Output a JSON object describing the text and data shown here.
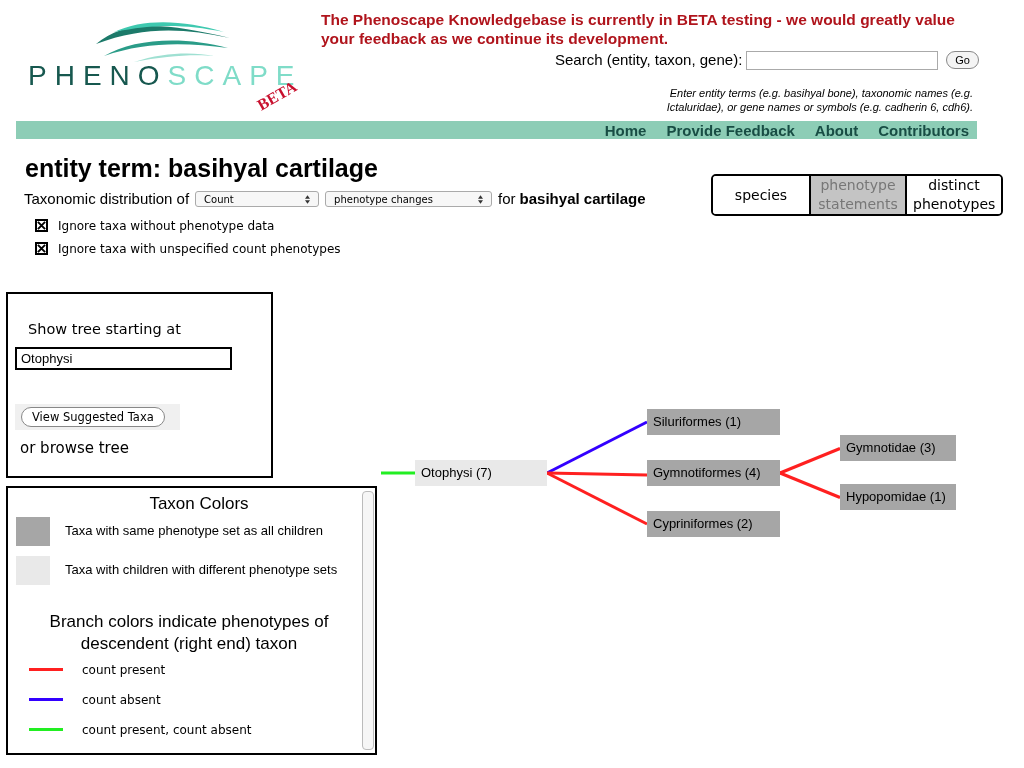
{
  "logo": {
    "text_dark": "PHENO",
    "text_light": "SCAPE",
    "badge": "BETA"
  },
  "notice": "The Phenoscape Knowledgebase is currently in BETA testing - we would greatly value your feedback as we continue its development.",
  "search": {
    "label": "Search (entity, taxon, gene):",
    "button": "Go",
    "hint": "Enter entity terms (e.g. basihyal bone), taxonomic names (e.g. Ictaluridae), or gene names or symbols (e.g. cadherin 6, cdh6)."
  },
  "nav": [
    "Home",
    "Provide Feedback",
    "About",
    "Contributors"
  ],
  "title": "entity term: basihyal cartilage",
  "distribution": {
    "prefix": "Taxonomic distribution of",
    "select_1": "Count",
    "select_2": "phenotype changes",
    "middle": "for",
    "term": "basihyal cartilage"
  },
  "options": [
    {
      "label": "Ignore taxa without phenotype data",
      "checked": true
    },
    {
      "label": "Ignore taxa with unspecified count phenotypes",
      "checked": true
    }
  ],
  "count_tabs": [
    {
      "label": "species",
      "selected": false
    },
    {
      "label": "phenotype statements",
      "selected": true
    },
    {
      "label": "distinct phenotypes",
      "selected": false
    }
  ],
  "tree_start": {
    "label": "Show tree starting at",
    "value": "Otophysi",
    "button": "View Suggested Taxa",
    "browse": "or browse tree"
  },
  "legend": {
    "title": "Taxon Colors",
    "taxon_colors": [
      {
        "kind": "uniform",
        "label": "Taxa with same phenotype set as all children"
      },
      {
        "kind": "mixed",
        "label": "Taxa with children with different phenotype sets"
      }
    ],
    "branch_title": "Branch colors indicate phenotypes of descendent (right end) taxon",
    "branch_colors": [
      {
        "color": "#ff2020",
        "label": "count present"
      },
      {
        "color": "#3300ff",
        "label": "count absent"
      },
      {
        "color": "#22ee22",
        "label": "count present, count absent"
      }
    ]
  },
  "tree": {
    "label": "Otophysi (7)",
    "kind": "mixed",
    "color": "#22ee22",
    "children": [
      {
        "label": "Siluriformes (1)",
        "kind": "uniform",
        "color": "#3300ff"
      },
      {
        "label": "Gymnotiformes (4)",
        "kind": "uniform",
        "color": "#ff2020",
        "children": [
          {
            "label": "Gymnotidae (3)",
            "kind": "uniform",
            "color": "#ff2020"
          },
          {
            "label": "Hypopomidae (1)",
            "kind": "uniform",
            "color": "#ff2020"
          }
        ]
      },
      {
        "label": "Cypriniformes (2)",
        "kind": "uniform",
        "color": "#ff2020"
      }
    ]
  }
}
